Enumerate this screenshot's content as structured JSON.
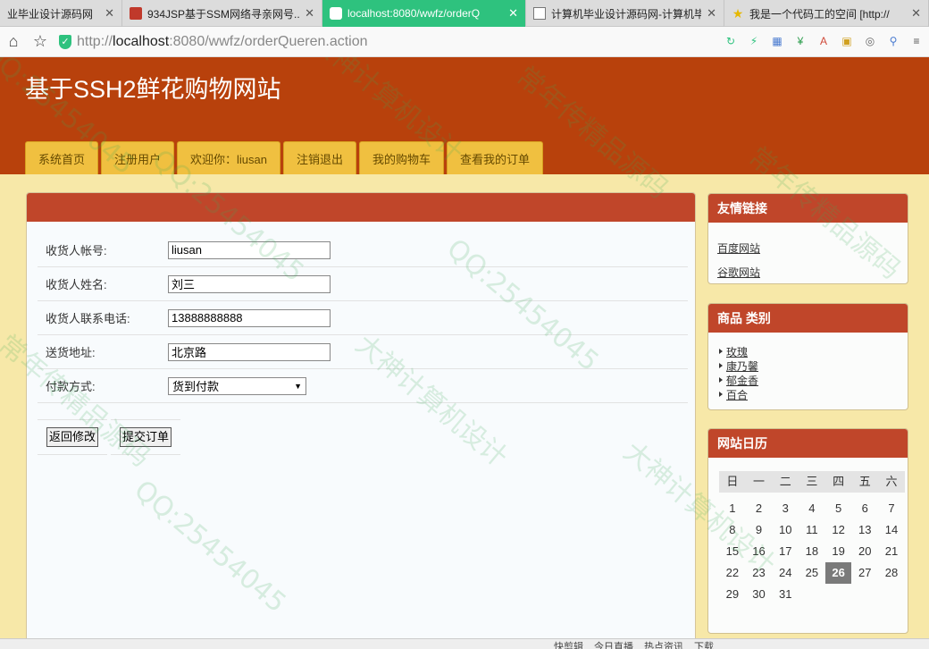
{
  "browser": {
    "tabs": [
      {
        "title": "业毕业设计源码网",
        "active": false
      },
      {
        "title": "934JSP基于SSM网络寻亲网号...",
        "active": false
      },
      {
        "title": "localhost:8080/wwfz/orderQ",
        "active": true
      },
      {
        "title": "计算机毕业设计源码网-计算机毕",
        "active": false
      },
      {
        "title": "我是一个代码工的空间 [http://",
        "active": false
      }
    ],
    "url_scheme": "http://",
    "url_host": "localhost",
    "url_rest": ":8080/wwfz/orderQueren.action"
  },
  "site": {
    "title": "基于SSH2鲜花购物网站",
    "nav": [
      "系统首页",
      "注册用户",
      "欢迎你：liusan",
      "注销退出",
      "我的购物车",
      "查看我的订单"
    ]
  },
  "form": {
    "account_label": "收货人帐号:",
    "account_value": "liusan",
    "name_label": "收货人姓名:",
    "name_value": "刘三",
    "phone_label": "收货人联系电话:",
    "phone_value": "13888888888",
    "address_label": "送货地址:",
    "address_value": "北京路",
    "payment_label": "付款方式:",
    "payment_value": "货到付款",
    "back_button": "返回修改",
    "submit_button": "提交订单"
  },
  "sidebar": {
    "links_title": "友情链接",
    "links": [
      "百度网站",
      "谷歌网站"
    ],
    "categories_title": "商品 类别",
    "categories": [
      "玫瑰",
      "康乃馨",
      "郁金香",
      "百合"
    ],
    "calendar_title": "网站日历",
    "weekdays": [
      "日",
      "一",
      "二",
      "三",
      "四",
      "五",
      "六"
    ],
    "weeks": [
      [
        "1",
        "2",
        "3",
        "4",
        "5",
        "6",
        "7"
      ],
      [
        "8",
        "9",
        "10",
        "11",
        "12",
        "13",
        "14"
      ],
      [
        "15",
        "16",
        "17",
        "18",
        "19",
        "20",
        "21"
      ],
      [
        "22",
        "23",
        "24",
        "25",
        "26",
        "27",
        "28"
      ],
      [
        "29",
        "30",
        "31",
        "",
        "",
        "",
        ""
      ]
    ],
    "today": "26"
  },
  "statusbar": {
    "items": [
      "快剪辑",
      "今日直播",
      "热点资讯",
      "下载"
    ]
  },
  "watermarks": [
    "QQ:25454045",
    "大神计算机设计",
    "常年传精品源码",
    "QQ:25454045",
    "常年传精品源码",
    "大神计算机设计",
    "QQ:25454045",
    "常年传精品源码",
    "QQ:25454045",
    "大神计算机设计"
  ]
}
